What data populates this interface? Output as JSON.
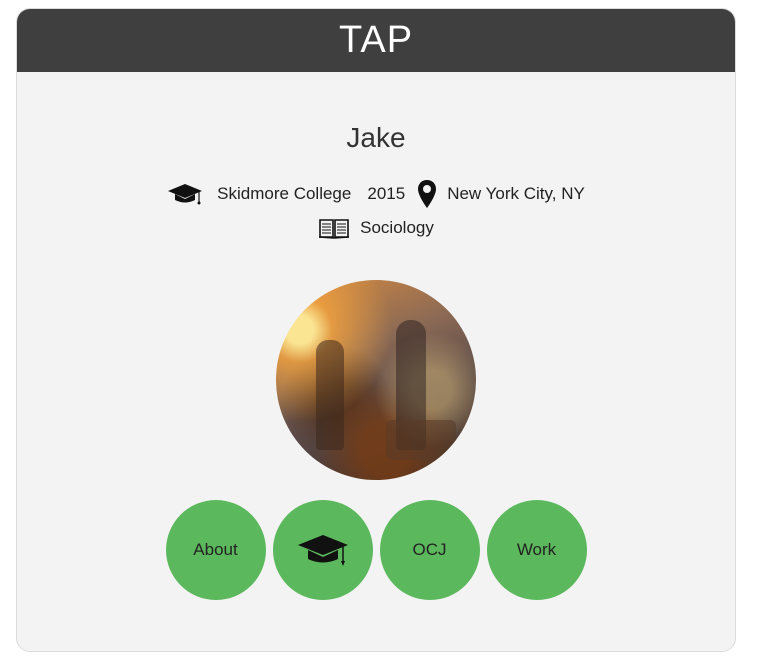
{
  "header": {
    "title": "TAP"
  },
  "profile": {
    "name": "Jake",
    "school": "Skidmore College",
    "year": "2015",
    "location": "New York City, NY",
    "major": "Sociology",
    "photo_icon": "profile-photo"
  },
  "icons": {
    "school": "graduation-cap-icon",
    "location": "map-pin-icon",
    "major": "open-book-icon"
  },
  "nav": {
    "about_label": "About",
    "education_icon": "graduation-cap-icon",
    "ocj_label": "OCJ",
    "work_label": "Work"
  },
  "colors": {
    "header_bg": "#3f3f3f",
    "card_bg": "#f3f3f3",
    "button_green": "#5cb85c"
  }
}
